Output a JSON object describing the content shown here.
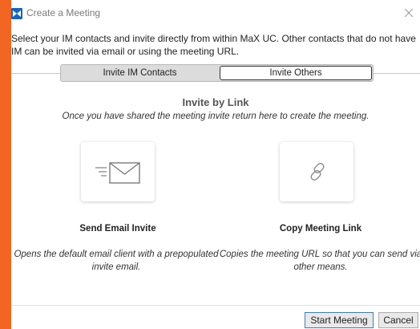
{
  "window": {
    "title": "Create a Meeting"
  },
  "description": "Select your IM contacts and invite directly from within MaX UC.  Other contacts that do not have IM can be invited via email or using the meeting URL.",
  "tabs": [
    {
      "label": "Invite IM Contacts",
      "selected": false
    },
    {
      "label": "Invite Others",
      "selected": true
    }
  ],
  "invite_by_link": {
    "title": "Invite by Link",
    "subtitle": "Once you have shared the meeting invite return here to create the meeting."
  },
  "options": {
    "email": {
      "icon": "email-envelope-icon",
      "title": "Send Email Invite",
      "description": "Opens the default email client with a prepopulated invite email."
    },
    "link": {
      "icon": "link-icon",
      "title": "Copy Meeting Link",
      "description": "Copies the meeting URL so that you can send via other means."
    }
  },
  "buttons": {
    "start": "Start Meeting",
    "cancel": "Cancel"
  },
  "colors": {
    "background_accent": "#f26522",
    "app_icon": "#1565c0",
    "primary_border": "#3c7fb1"
  }
}
